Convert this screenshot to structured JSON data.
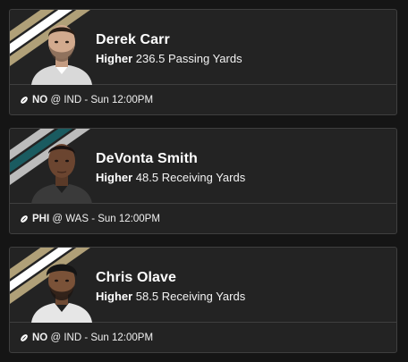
{
  "colors": {
    "background": "#151515",
    "card": "#232323",
    "border": "#3f3f3f",
    "saints_gold": "#b0a078",
    "eagles_green": "#1a5b60",
    "eagles_silver": "#bcbcbc",
    "white": "#ffffff"
  },
  "cards": [
    {
      "player": "Derek Carr",
      "direction": "Higher",
      "line": "236.5",
      "stat": "Passing Yards",
      "team": "NO",
      "matchup": "@ IND - Sun 12:00PM",
      "icon": "football-icon"
    },
    {
      "player": "DeVonta Smith",
      "direction": "Higher",
      "line": "48.5",
      "stat": "Receiving Yards",
      "team": "PHI",
      "matchup": "@ WAS - Sun 12:00PM",
      "icon": "football-icon"
    },
    {
      "player": "Chris Olave",
      "direction": "Higher",
      "line": "58.5",
      "stat": "Receiving Yards",
      "team": "NO",
      "matchup": "@ IND - Sun 12:00PM",
      "icon": "football-icon"
    }
  ]
}
